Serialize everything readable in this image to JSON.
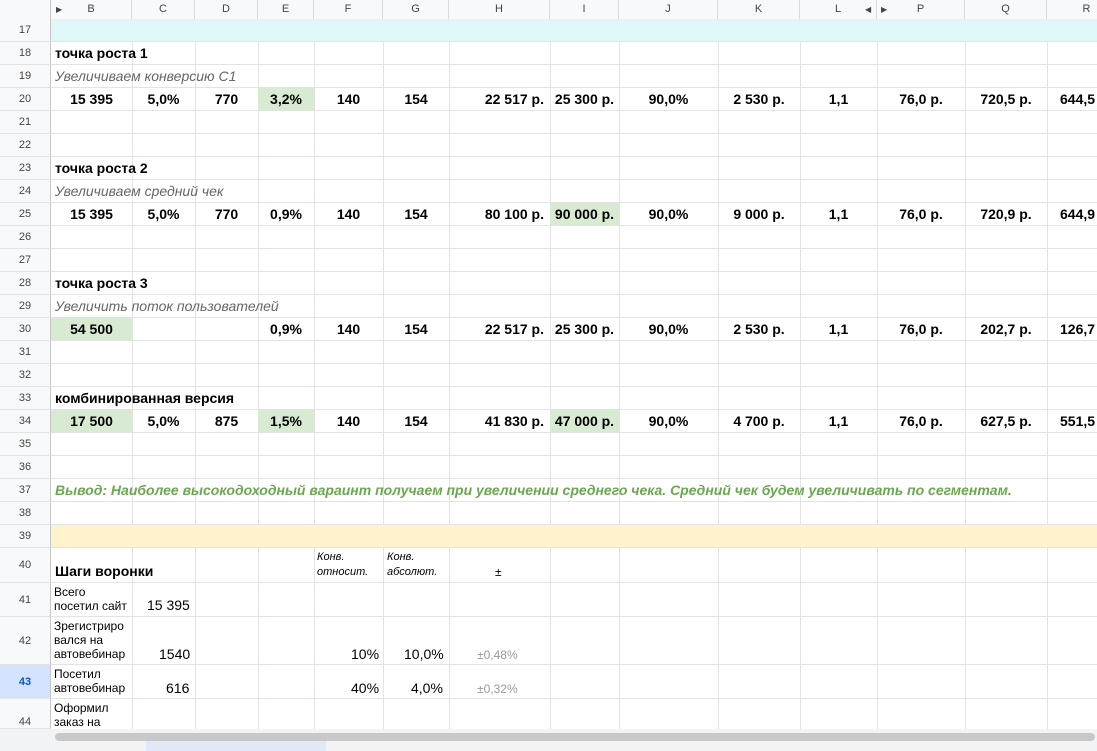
{
  "columns": [
    "B",
    "C",
    "D",
    "E",
    "F",
    "G",
    "H",
    "I",
    "J",
    "K",
    "L",
    "P",
    "Q",
    "R"
  ],
  "row_numbers": [
    "17",
    "18",
    "19",
    "20",
    "21",
    "22",
    "23",
    "24",
    "25",
    "26",
    "27",
    "28",
    "29",
    "30",
    "31",
    "32",
    "33",
    "34",
    "35",
    "36",
    "37",
    "38",
    "39",
    "40",
    "41",
    "42",
    "43",
    "44"
  ],
  "point1": {
    "title": "точка роста 1",
    "subtitle": "Увеличиваем конверсию С1",
    "values": [
      "15 395",
      "5,0%",
      "770",
      "3,2%",
      "140",
      "154",
      "22 517 р.",
      "25 300 р.",
      "90,0%",
      "2 530 р.",
      "1,1",
      "76,0 р.",
      "720,5 р.",
      "644,5"
    ]
  },
  "point2": {
    "title": "точка роста 2",
    "subtitle": "Увеличиваем средний чек",
    "values": [
      "15 395",
      "5,0%",
      "770",
      "0,9%",
      "140",
      "154",
      "80 100 р.",
      "90 000 р.",
      "90,0%",
      "9 000 р.",
      "1,1",
      "76,0 р.",
      "720,9 р.",
      "644,9"
    ]
  },
  "point3": {
    "title": "точка роста 3",
    "subtitle": "Увеличить поток пользователей",
    "values": [
      "54 500",
      "",
      "",
      "0,9%",
      "140",
      "154",
      "22 517 р.",
      "25 300 р.",
      "90,0%",
      "2 530 р.",
      "1,1",
      "76,0 р.",
      "202,7 р.",
      "126,7"
    ]
  },
  "combined": {
    "title": "комбинированная версия",
    "values": [
      "17 500",
      "5,0%",
      "875",
      "1,5%",
      "140",
      "154",
      "41 830 р.",
      "47 000 р.",
      "90,0%",
      "4 700 р.",
      "1,1",
      "76,0 р.",
      "627,5 р.",
      "551,5"
    ]
  },
  "conclusion": "Вывод: Наиболее высокодоходный вараинт получаем при увеличении среднего чека. Средний чек будем увеличивать по сегментам.",
  "funnel": {
    "title": "Шаги воронки",
    "col_rel_1": "Конв.",
    "col_rel_2": "относит.",
    "col_abs_1": "Конв.",
    "col_abs_2": "абсолют.",
    "col_pm": "±",
    "rows": [
      {
        "label": [
          "Всего",
          "посетил сайт"
        ],
        "value": "15 395",
        "rel": "",
        "abs": "",
        "pm": ""
      },
      {
        "label": [
          "Зрегистриро",
          "вался на",
          "автовебинар"
        ],
        "value": "1540",
        "rel": "10%",
        "abs": "10,0%",
        "pm": "±0,48%"
      },
      {
        "label": [
          "Посетил",
          "автовебинар"
        ],
        "value": "616",
        "rel": "40%",
        "abs": "4,0%",
        "pm": "±0,32%"
      },
      {
        "label": [
          "Оформил",
          "заказ на"
        ],
        "value": "",
        "rel": "",
        "abs": "",
        "pm": ""
      }
    ]
  },
  "colors": {
    "green": "#d9ead3",
    "teal_band": "#e0f7fa",
    "yellow_band": "#fff2cc",
    "conclusion": "#6aa84f"
  }
}
